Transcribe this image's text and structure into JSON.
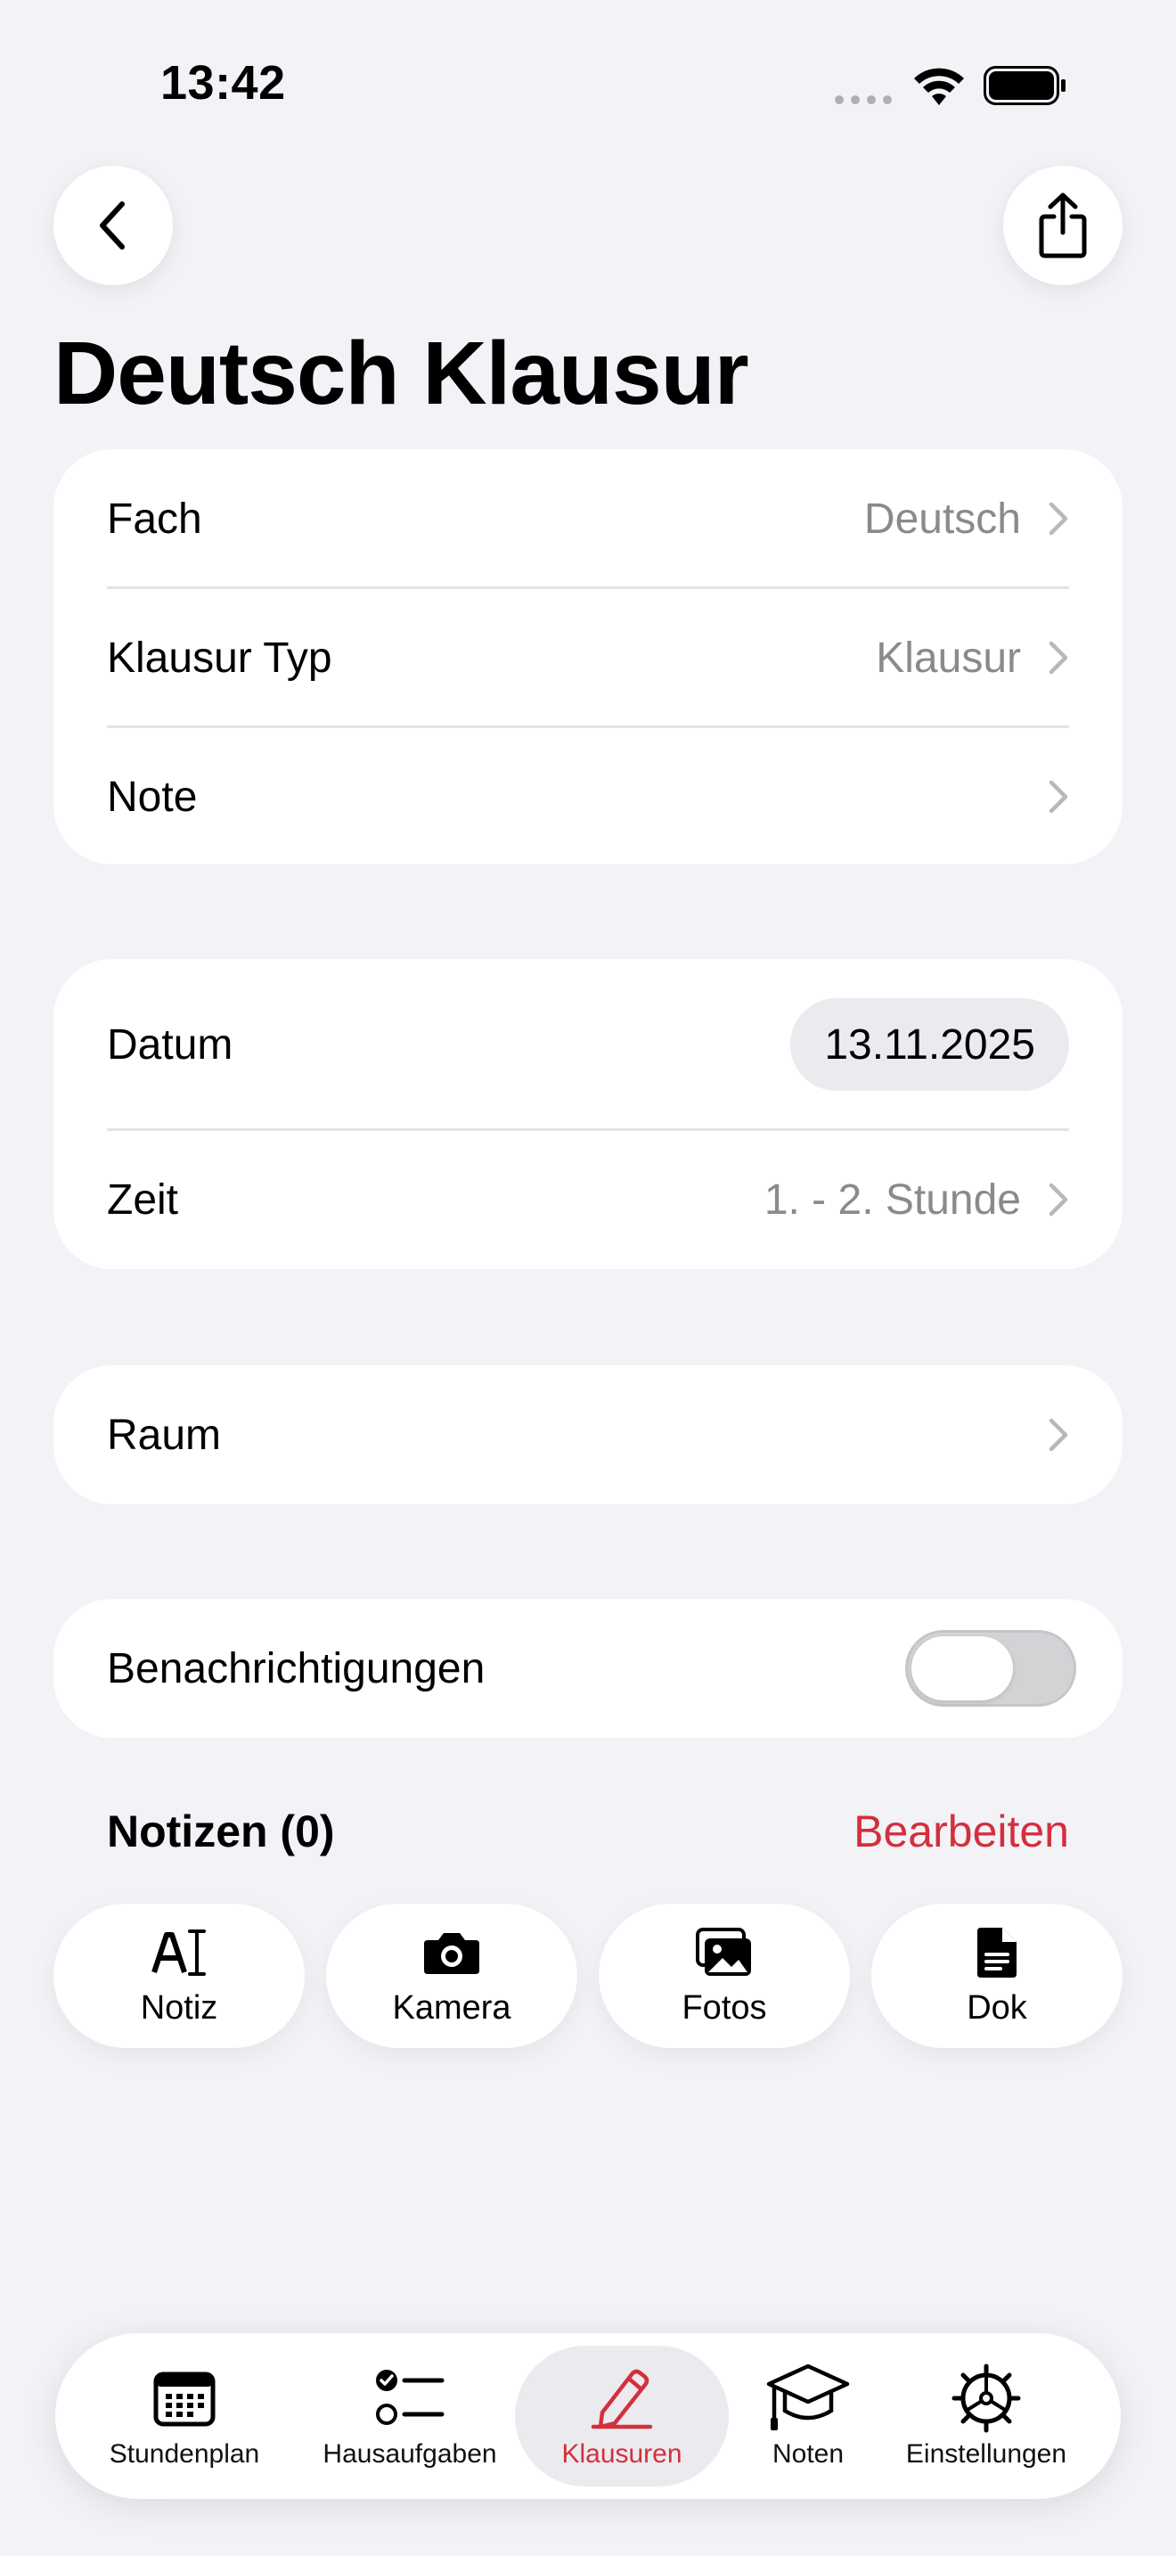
{
  "status_bar": {
    "time": "13:42"
  },
  "title": "Deutsch Klausur",
  "card1": {
    "rows": [
      {
        "label": "Fach",
        "value": "Deutsch"
      },
      {
        "label": "Klausur Typ",
        "value": "Klausur"
      },
      {
        "label": "Note",
        "value": ""
      }
    ]
  },
  "card2": {
    "date_label": "Datum",
    "date_value": "13.11.2025",
    "time_label": "Zeit",
    "time_value": "1. - 2. Stunde"
  },
  "card3": {
    "label": "Raum"
  },
  "card4": {
    "label": "Benachrichtigungen",
    "toggle_on": false
  },
  "notes": {
    "heading": "Notizen (0)",
    "edit": "Bearbeiten"
  },
  "attachments": [
    {
      "label": "Notiz",
      "icon": "text-cursor-icon"
    },
    {
      "label": "Kamera",
      "icon": "camera-icon"
    },
    {
      "label": "Fotos",
      "icon": "photos-icon"
    },
    {
      "label": "Dok",
      "icon": "document-icon"
    }
  ],
  "tabbar": {
    "active": "Klausuren",
    "tabs": [
      {
        "label": "Stundenplan",
        "icon": "calendar-icon"
      },
      {
        "label": "Hausaufgaben",
        "icon": "checklist-icon"
      },
      {
        "label": "Klausuren",
        "icon": "pencil-icon"
      },
      {
        "label": "Noten",
        "icon": "graduation-cap-icon"
      },
      {
        "label": "Einstellungen",
        "icon": "gear-icon"
      }
    ]
  },
  "colors": {
    "accent": "#d32f3c",
    "background": "#f2f2f7",
    "secondary_text": "#8a8a8e"
  }
}
